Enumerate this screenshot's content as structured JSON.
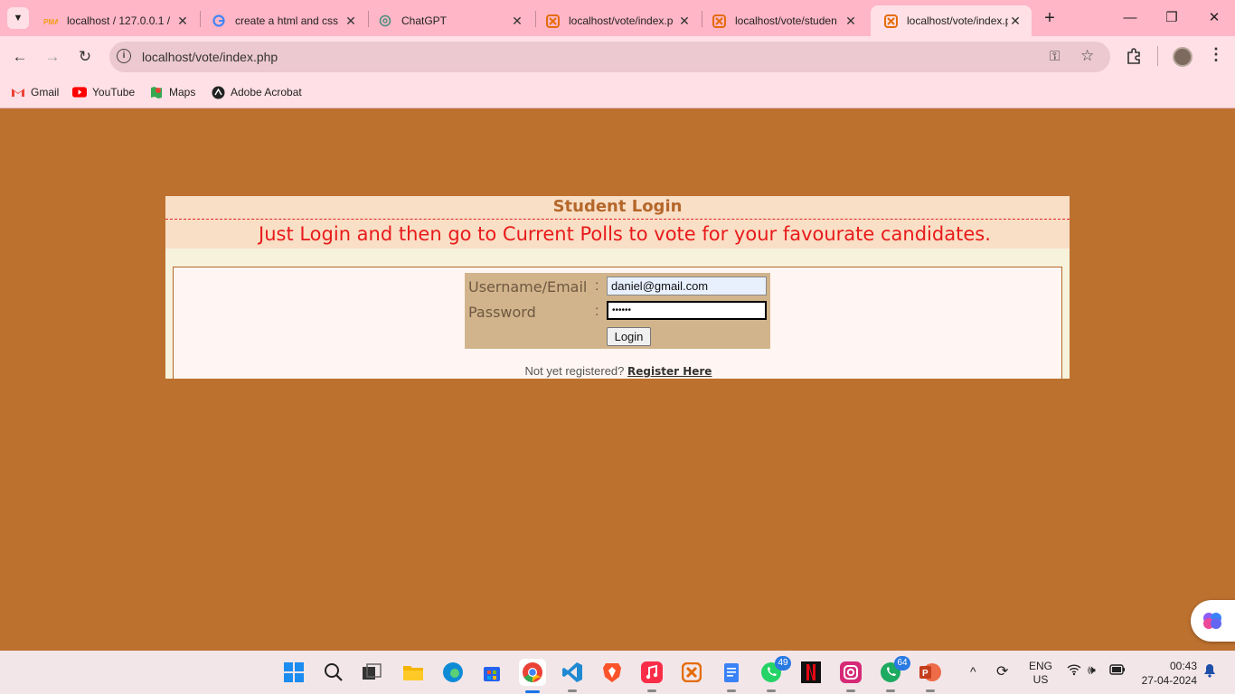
{
  "browser": {
    "tabs": [
      {
        "title": "localhost / 127.0.0.1 / ",
        "icon": "phpmyadmin-icon"
      },
      {
        "title": "create a html and css",
        "icon": "google-icon"
      },
      {
        "title": "ChatGPT",
        "icon": "chatgpt-icon"
      },
      {
        "title": "localhost/vote/index.p",
        "icon": "xampp-icon"
      },
      {
        "title": "localhost/vote/studen",
        "icon": "xampp-icon"
      },
      {
        "title": "localhost/vote/index.p",
        "icon": "xampp-icon",
        "active": true
      }
    ],
    "address_url": "localhost/vote/index.php",
    "bookmarks": [
      {
        "label": "Gmail",
        "icon": "gmail-icon"
      },
      {
        "label": "YouTube",
        "icon": "youtube-icon"
      },
      {
        "label": "Maps",
        "icon": "maps-icon"
      },
      {
        "label": "Adobe Acrobat",
        "icon": "acrobat-icon"
      }
    ],
    "theme_color": "#FFB6C6"
  },
  "page": {
    "background_color": "#BD712F",
    "title": "Student Login",
    "message": "Just Login and then go to Current Polls to vote for your favourate candidates.",
    "form": {
      "username_label": "Username/Email",
      "password_label": "Password",
      "colon": ":",
      "username_value": "daniel@gmail.com",
      "password_value": "••••••",
      "login_label": "Login"
    },
    "register_prompt": "Not yet registered?",
    "register_link": "Register Here"
  },
  "taskbar": {
    "whatsapp_badge": "49",
    "whatsapp_badge2": "64",
    "language": "ENG",
    "region": "US",
    "time": "00:43",
    "date": "27-04-2024"
  }
}
